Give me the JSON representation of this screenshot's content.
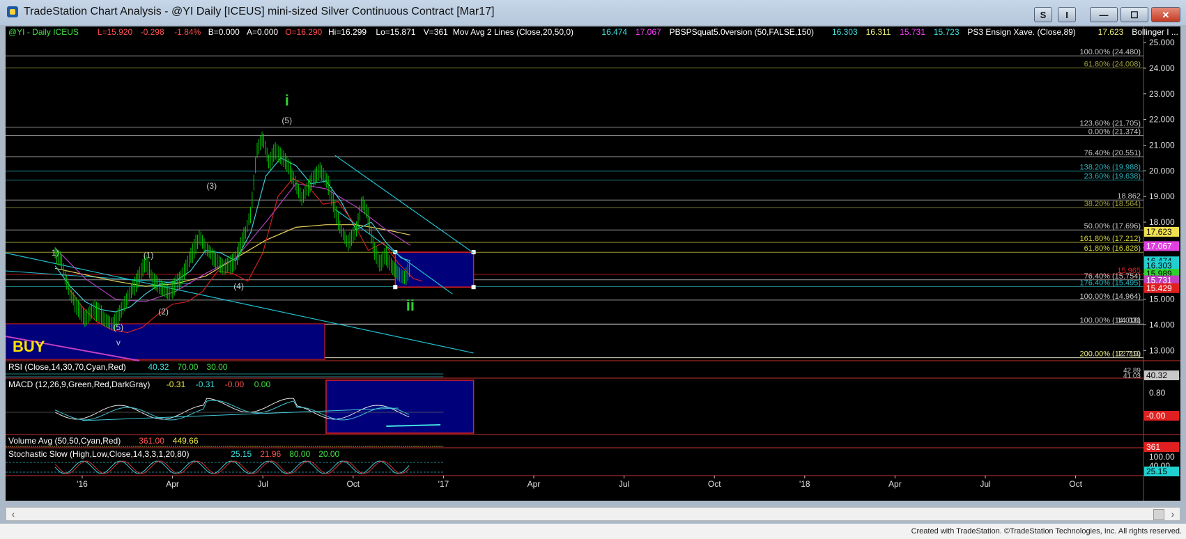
{
  "window": {
    "title": "TradeStation Chart Analysis - @YI Daily [ICEUS] mini-sized Silver Continuous Contract [Mar17]",
    "btn_s": "S",
    "btn_i": "I",
    "btn_min": "—",
    "btn_max": "☐",
    "btn_close": "✕"
  },
  "footer": {
    "text": "Created with TradeStation. ©TradeStation Technologies, Inc. All rights reserved."
  },
  "colors": {
    "bg": "#000000",
    "up": "#00c800",
    "cyan": "#00c8d8",
    "red": "#e02020",
    "yellow": "#f0e050",
    "magenta": "#c040c0",
    "navy": "#00007a"
  },
  "header": {
    "segments": [
      {
        "text": "@YI - Daily  ICEUS",
        "color": "#40e040"
      },
      {
        "text": "L=15.920",
        "color": "#ff5050"
      },
      {
        "text": "-0.298",
        "color": "#ff5050"
      },
      {
        "text": "-1.84%",
        "color": "#ff5050"
      },
      {
        "text": "B=0.000",
        "color": "#ffffff"
      },
      {
        "text": "A=0.000",
        "color": "#ffffff"
      },
      {
        "text": "O=16.290",
        "color": "#ff5050"
      },
      {
        "text": "Hi=16.299",
        "color": "#ffffff"
      },
      {
        "text": "Lo=15.871",
        "color": "#ffffff"
      },
      {
        "text": "V=361",
        "color": "#ffffff"
      },
      {
        "text": "Mov Avg 2 Lines (Close,20,50,0)",
        "color": "#ffffff"
      },
      {
        "text": "16.474",
        "color": "#40e0e0"
      },
      {
        "text": "17.067",
        "color": "#ff40ff"
      },
      {
        "text": "PBSPSquat5.0version (50,FALSE,150)",
        "color": "#ffffff"
      },
      {
        "text": "16.303",
        "color": "#40e0e0"
      },
      {
        "text": "16.311",
        "color": "#f0f080"
      },
      {
        "text": "15.731",
        "color": "#ff40ff"
      },
      {
        "text": "15.723",
        "color": "#40e0e0"
      },
      {
        "text": "PS3 Ensign Xave. (Close,89)",
        "color": "#ffffff"
      },
      {
        "text": "17.623",
        "color": "#f0f080"
      },
      {
        "text": "Bollinger I ...",
        "color": "#ffffff"
      }
    ]
  },
  "chart_data": {
    "type": "line",
    "symbol": "@YI",
    "x_ticks": [
      "'16",
      "Apr",
      "Jul",
      "Oct",
      "'17",
      "Apr",
      "Jul",
      "Oct",
      "'18",
      "Apr",
      "Jul",
      "Oct"
    ],
    "y_ticks": [
      "25.000",
      "24.000",
      "23.000",
      "22.000",
      "21.000",
      "20.000",
      "19.000",
      "18.000",
      "17.000",
      "16.000",
      "15.000",
      "14.000",
      "13.000"
    ],
    "ylim": [
      12.6,
      25.3
    ],
    "price_path": [
      [
        0,
        16.8
      ],
      [
        0.2,
        16.6
      ],
      [
        0.3,
        16.0
      ],
      [
        0.5,
        15.2
      ],
      [
        0.8,
        14.6
      ],
      [
        1.0,
        14.2
      ],
      [
        1.3,
        14.6
      ],
      [
        1.6,
        14.3
      ],
      [
        1.9,
        14.0
      ],
      [
        2.2,
        14.6
      ],
      [
        2.5,
        15.2
      ],
      [
        2.8,
        15.9
      ],
      [
        3.0,
        16.4
      ],
      [
        3.2,
        15.9
      ],
      [
        3.5,
        15.5
      ],
      [
        3.8,
        15.2
      ],
      [
        4.0,
        15.6
      ],
      [
        4.2,
        15.8
      ],
      [
        4.5,
        16.6
      ],
      [
        4.8,
        17.5
      ],
      [
        5.0,
        17.0
      ],
      [
        5.3,
        16.6
      ],
      [
        5.6,
        16.2
      ],
      [
        6.0,
        16.5
      ],
      [
        6.3,
        17.5
      ],
      [
        6.5,
        18.4
      ],
      [
        6.7,
        20.8
      ],
      [
        6.9,
        21.3
      ],
      [
        7.1,
        20.3
      ],
      [
        7.3,
        20.8
      ],
      [
        7.6,
        20.4
      ],
      [
        7.9,
        19.8
      ],
      [
        8.2,
        18.9
      ],
      [
        8.5,
        19.6
      ],
      [
        8.8,
        20.0
      ],
      [
        9.1,
        19.4
      ],
      [
        9.4,
        18.0
      ],
      [
        9.7,
        17.2
      ],
      [
        10.0,
        17.7
      ],
      [
        10.2,
        18.8
      ],
      [
        10.4,
        18.2
      ],
      [
        10.6,
        16.9
      ],
      [
        10.8,
        16.3
      ],
      [
        11.0,
        16.7
      ],
      [
        11.2,
        16.3
      ],
      [
        11.4,
        16.0
      ],
      [
        11.6,
        15.8
      ],
      [
        11.8,
        16.3
      ]
    ],
    "ma20_path": [
      [
        0,
        16.3
      ],
      [
        0.5,
        15.5
      ],
      [
        1,
        14.9
      ],
      [
        1.5,
        14.6
      ],
      [
        2,
        14.5
      ],
      [
        2.5,
        14.7
      ],
      [
        3,
        15.2
      ],
      [
        3.5,
        15.6
      ],
      [
        4,
        15.7
      ],
      [
        4.5,
        16.1
      ],
      [
        5,
        16.9
      ],
      [
        5.5,
        16.8
      ],
      [
        6,
        16.5
      ],
      [
        6.5,
        17.6
      ],
      [
        7,
        19.8
      ],
      [
        7.5,
        20.5
      ],
      [
        8,
        20.2
      ],
      [
        8.5,
        19.5
      ],
      [
        9,
        19.6
      ],
      [
        9.5,
        18.8
      ],
      [
        10,
        17.7
      ],
      [
        10.5,
        18.0
      ],
      [
        11,
        17.2
      ],
      [
        11.5,
        16.6
      ],
      [
        11.8,
        16.5
      ]
    ],
    "ma50_path": [
      [
        0,
        17.0
      ],
      [
        1,
        15.8
      ],
      [
        2,
        15.0
      ],
      [
        3,
        14.9
      ],
      [
        4,
        15.3
      ],
      [
        5,
        16.0
      ],
      [
        6,
        16.6
      ],
      [
        7,
        18.0
      ],
      [
        8,
        19.5
      ],
      [
        9,
        19.3
      ],
      [
        10,
        18.6
      ],
      [
        11,
        17.7
      ],
      [
        11.8,
        17.1
      ]
    ],
    "ma_long_path": [
      [
        0,
        16.2
      ],
      [
        2,
        15.7
      ],
      [
        3,
        15.5
      ],
      [
        4,
        15.6
      ],
      [
        5,
        15.9
      ],
      [
        6,
        16.6
      ],
      [
        7,
        17.3
      ],
      [
        8,
        17.8
      ],
      [
        9,
        17.9
      ],
      [
        10,
        17.9
      ],
      [
        11,
        17.7
      ],
      [
        11.8,
        17.5
      ]
    ],
    "wave_labels": [
      {
        "text": "i",
        "x": 7.7,
        "y": 22.55,
        "color": "#30d030",
        "size": "big"
      },
      {
        "text": "(5)",
        "x": 7.7,
        "y": 21.85,
        "color": "#cccccc",
        "size": "small"
      },
      {
        "text": "(3)",
        "x": 5.2,
        "y": 19.3,
        "color": "#cccccc",
        "size": "small"
      },
      {
        "text": "(1)",
        "x": 3.1,
        "y": 16.6,
        "color": "#cccccc",
        "size": "small"
      },
      {
        "text": "(4)",
        "x": 6.1,
        "y": 15.4,
        "color": "#cccccc",
        "size": "small"
      },
      {
        "text": "(2)",
        "x": 3.6,
        "y": 14.4,
        "color": "#cccccc",
        "size": "small"
      },
      {
        "text": "(5)",
        "x": 2.1,
        "y": 13.8,
        "color": "#cccccc",
        "size": "small"
      },
      {
        "text": "v",
        "x": 2.1,
        "y": 13.2,
        "color": "#cccccc",
        "size": "small"
      },
      {
        "text": "ii",
        "x": 11.8,
        "y": 14.55,
        "color": "#30d030",
        "size": "big"
      },
      {
        "text": "1)",
        "x": 0.0,
        "y": 16.7,
        "color": "#cccccc",
        "size": "small"
      }
    ],
    "fib_levels": [
      {
        "label": "100.00% (24.480)",
        "value": 24.48,
        "color": "#c8c8c8"
      },
      {
        "label": "61.80% (24.008)",
        "value": 24.008,
        "color": "#a0a040"
      },
      {
        "label": "123.60% (21.705)",
        "value": 21.705,
        "color": "#c8c8c8"
      },
      {
        "label": "0.00% (21.374)",
        "value": 21.374,
        "color": "#c8c8c8"
      },
      {
        "label": "76.40% (20.551)",
        "value": 20.551,
        "color": "#c8c8c8"
      },
      {
        "label": "138.20% (19.988)",
        "value": 19.988,
        "color": "#2ab0b8"
      },
      {
        "label": "23.60% (19.638)",
        "value": 19.638,
        "color": "#2ab0b8"
      },
      {
        "label": "18.862",
        "value": 18.862,
        "color": "#c8c8c8"
      },
      {
        "label": "38.20% (18.564)",
        "value": 18.564,
        "color": "#a0a040"
      },
      {
        "label": "50.00% (17.696)",
        "value": 17.696,
        "color": "#c8c8c8"
      },
      {
        "label": "161.80% (17.212)",
        "value": 17.212,
        "color": "#d0d040"
      },
      {
        "label": "61.80% (16.828)",
        "value": 16.828,
        "color": "#d0d040"
      },
      {
        "label": "15.965",
        "value": 15.965,
        "color": "#e02020"
      },
      {
        "label": "76.40% (15.754)",
        "value": 15.754,
        "color": "#c8c8c8"
      },
      {
        "label": "176.40% (15.495)",
        "value": 15.495,
        "color": "#2ab0b8"
      },
      {
        "label": "100.00% (14.964)",
        "value": 14.964,
        "color": "#c8c8c8"
      },
      {
        "label": "100.00% (14.018)",
        "value": 14.018,
        "color": "#c8c8c8"
      },
      {
        "label": "14.031",
        "value": 14.031,
        "color": "#c8c8c8"
      },
      {
        "label": "200.00% (12.719)",
        "value": 12.719,
        "color": "#f0f080"
      },
      {
        "label": "12.719",
        "value": 12.719,
        "color": "#c8c8c8"
      }
    ],
    "right_markers": [
      {
        "text": "17.623",
        "value": 17.623,
        "bg": "#f0e050",
        "fg": "#000000"
      },
      {
        "text": "17.067",
        "value": 17.067,
        "bg": "#e040e0",
        "fg": "#ffffff"
      },
      {
        "text": "16.474",
        "value": 16.474,
        "bg": "#20d0d0",
        "fg": "#000000"
      },
      {
        "text": "16.303",
        "value": 16.303,
        "bg": "#20d0d0",
        "fg": "#000000"
      },
      {
        "text": "15.989",
        "value": 15.989,
        "bg": "#30d030",
        "fg": "#000000"
      },
      {
        "text": "15.731",
        "value": 15.731,
        "bg": "#c040c0",
        "fg": "#ffffff"
      },
      {
        "text": "15.429",
        "value": 15.429,
        "bg": "#e02020",
        "fg": "#ffffff"
      }
    ],
    "buy_label": "BUY",
    "rsi": {
      "label": "RSI (Close,14,30,70,Cyan,Red)",
      "value": "40.32",
      "upper": "70.00",
      "lower": "30.00",
      "side_text": "42.89",
      "side_text2": "41.03",
      "marker": "40.32"
    },
    "macd": {
      "label": "MACD (12,26,9,Green,Red,DarkGray)",
      "v1": "-0.31",
      "v2": "-0.31",
      "v3": "-0.00",
      "v4": "0.00",
      "tick_080": "0.80",
      "marker": "-0.00"
    },
    "volume": {
      "label": "Volume Avg (50,50,Cyan,Red)",
      "v1": "361.00",
      "v2": "449.66",
      "marker": "361"
    },
    "stoch": {
      "label": "Stochastic Slow (High,Low,Close,14,3,3,1,20,80)",
      "v1": "25.15",
      "v2": "21.96",
      "v3": "80.00",
      "v4": "20.00",
      "tick_100": "100.00",
      "tick_40": "40.00",
      "marker": "25.15"
    }
  }
}
